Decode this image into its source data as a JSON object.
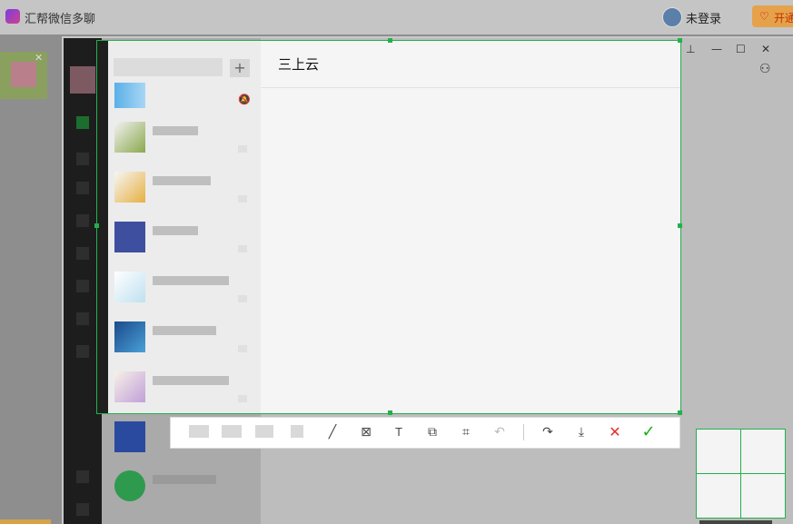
{
  "host_app": {
    "title": "汇帮微信多聊",
    "login_label": "未登录",
    "vip_label": "开通"
  },
  "chat": {
    "title": "三上云"
  },
  "search": {
    "plus_label": "+"
  },
  "toolbar": {
    "pen": "╱",
    "mosaic": "⊠",
    "text": "T",
    "pin": "⧉",
    "ocr": "⌗",
    "undo": "↶",
    "share": "↷",
    "save": "⤓",
    "cancel": "✕",
    "confirm": "✓"
  },
  "window_controls": {
    "pin": "⊥",
    "min": "—",
    "max": "☐",
    "close": "✕"
  },
  "colors": {
    "selection": "#22b14c",
    "cancel": "#e03030",
    "confirm": "#1aad19",
    "vip": "#e5a24a"
  }
}
